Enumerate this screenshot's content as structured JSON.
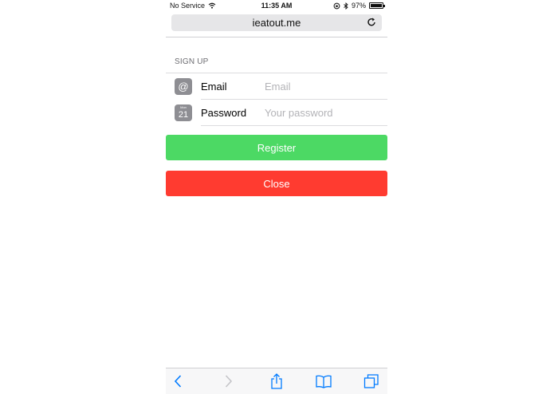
{
  "status_bar": {
    "carrier": "No Service",
    "time": "11:35 AM",
    "battery": "97%",
    "battery_level": 0.97
  },
  "browser": {
    "url": "ieatout.me"
  },
  "form": {
    "section_title": "SIGN UP",
    "email_label": "Email",
    "email_placeholder": "Email",
    "email_value": "",
    "password_label": "Password",
    "password_placeholder": "Your password",
    "password_value": "",
    "email_icon_glyph": "@",
    "calendar_icon_month": "Mon",
    "calendar_icon_day": "21"
  },
  "buttons": {
    "register": "Register",
    "close": "Close"
  },
  "colors": {
    "register": "#4cd964",
    "close": "#ff3b30",
    "icon_bg": "#8e8e93",
    "toolbar_tint": "#007aff"
  },
  "toolbar": {
    "icons": [
      "back-icon",
      "forward-icon",
      "share-icon",
      "bookmarks-icon",
      "tabs-icon"
    ]
  }
}
